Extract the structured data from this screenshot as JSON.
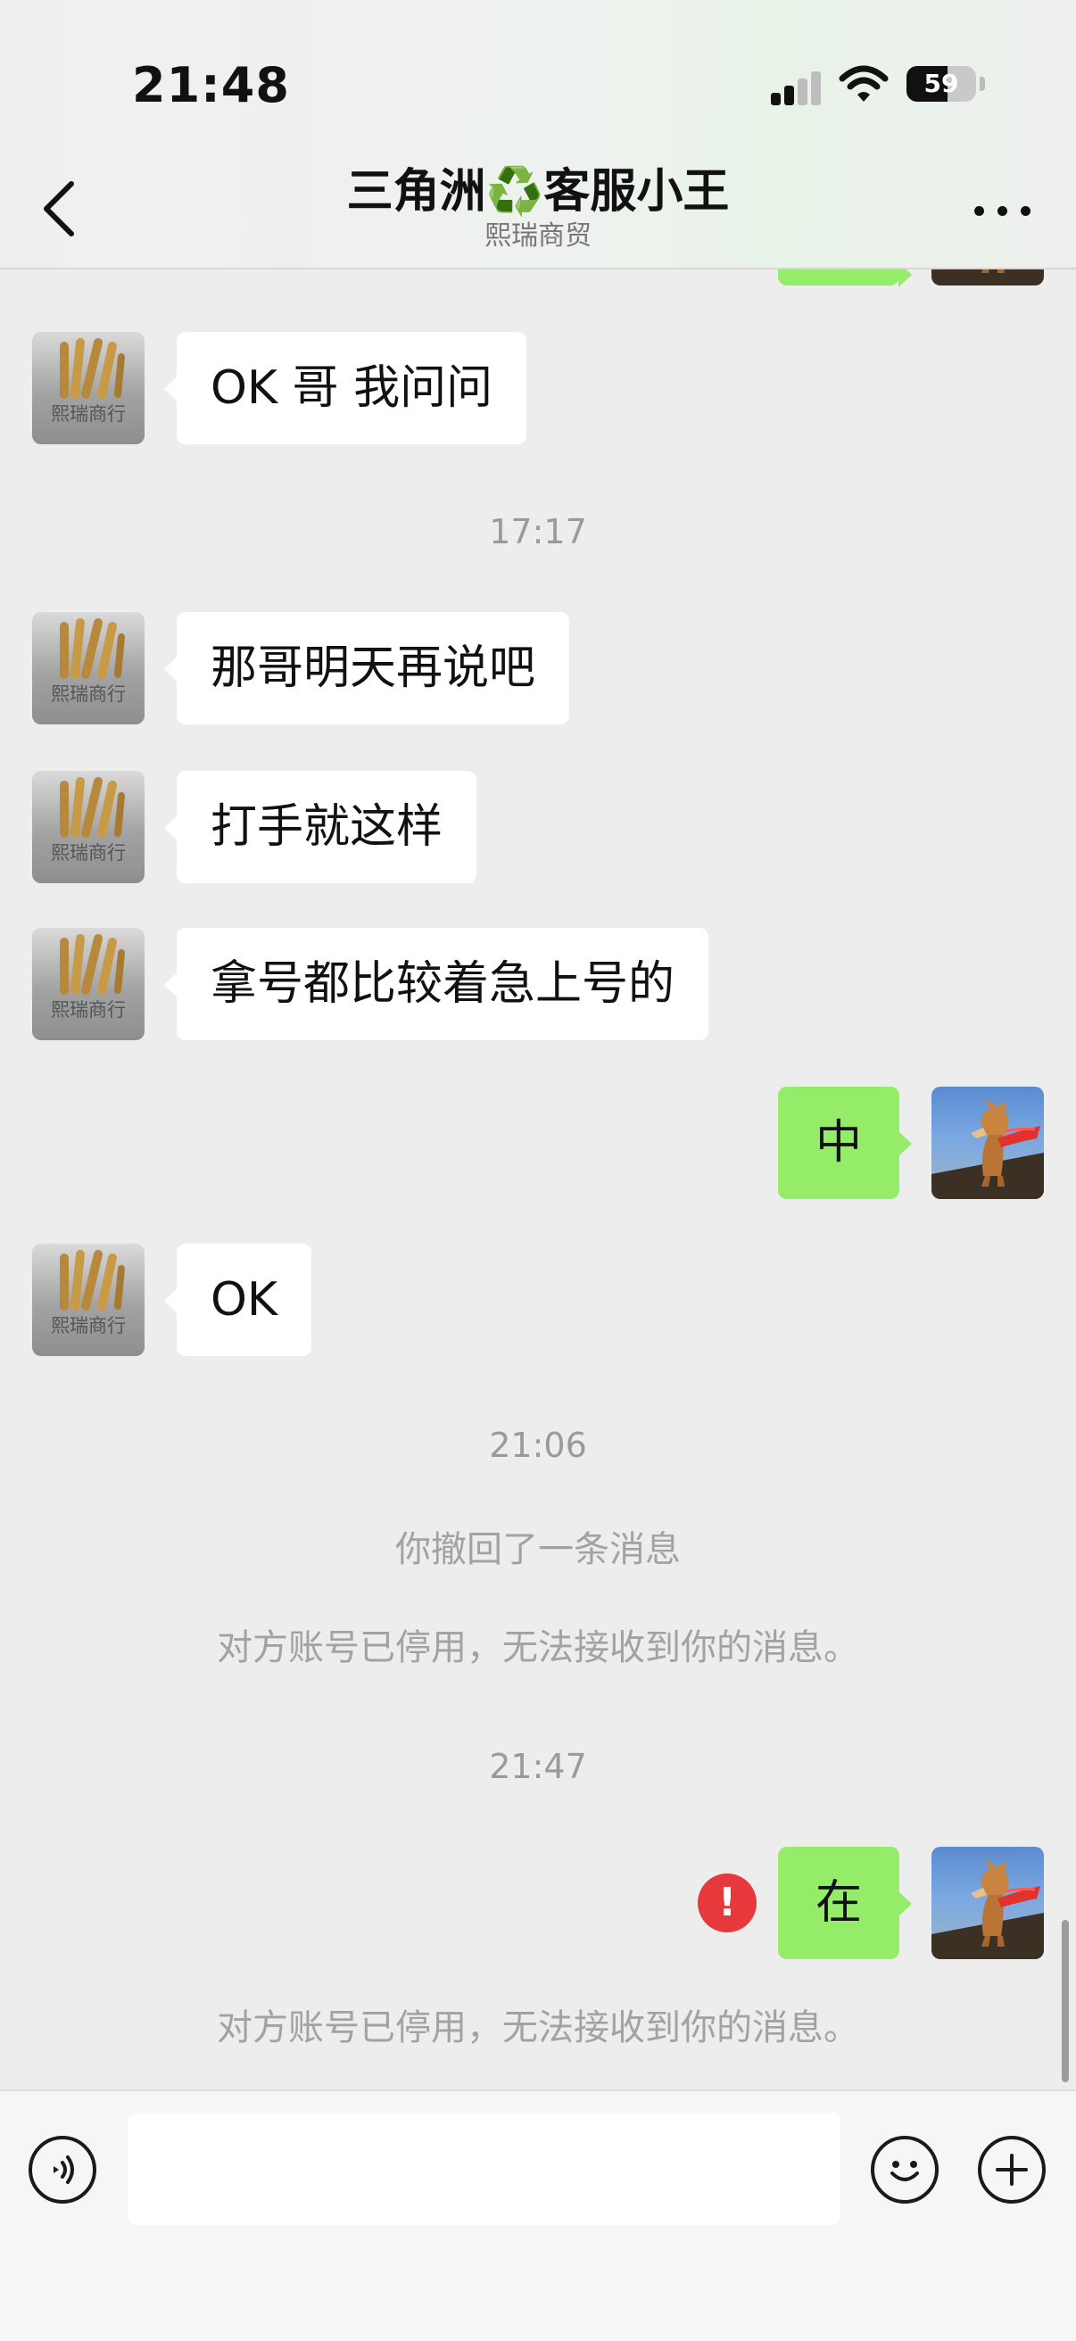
{
  "status_bar": {
    "time": "21:48",
    "battery": "59"
  },
  "header": {
    "title": "三角洲♻️客服小王",
    "subtitle": "熙瑞商贸"
  },
  "avatars": {
    "company": {
      "label": "熙瑞商行"
    }
  },
  "messages": {
    "m1": "OK 哥 我问问",
    "ts1": "17:17",
    "m2": "那哥明天再说吧",
    "m3": "打手就这样",
    "m4": "拿号都比较着急上号的",
    "m5": "中",
    "m6": "OK",
    "ts2": "21:06",
    "sys1": "你撤回了一条消息",
    "sys2": "对方账号已停用，无法接收到你的消息。",
    "ts3": "21:47",
    "m7": "在",
    "send_error": "!",
    "sys3": "对方账号已停用，无法接收到你的消息。"
  },
  "input": {
    "placeholder": ""
  },
  "colors": {
    "background": "#ededed",
    "incoming_bubble": "#ffffff",
    "outgoing_bubble": "#95ec69",
    "error": "#e6393c"
  },
  "icons": {
    "back": "chevron-left-icon",
    "more": "more-dots-icon",
    "voice": "voice-icon",
    "emoji": "emoji-icon",
    "add": "plus-icon",
    "recycle": "recycle-icon"
  }
}
